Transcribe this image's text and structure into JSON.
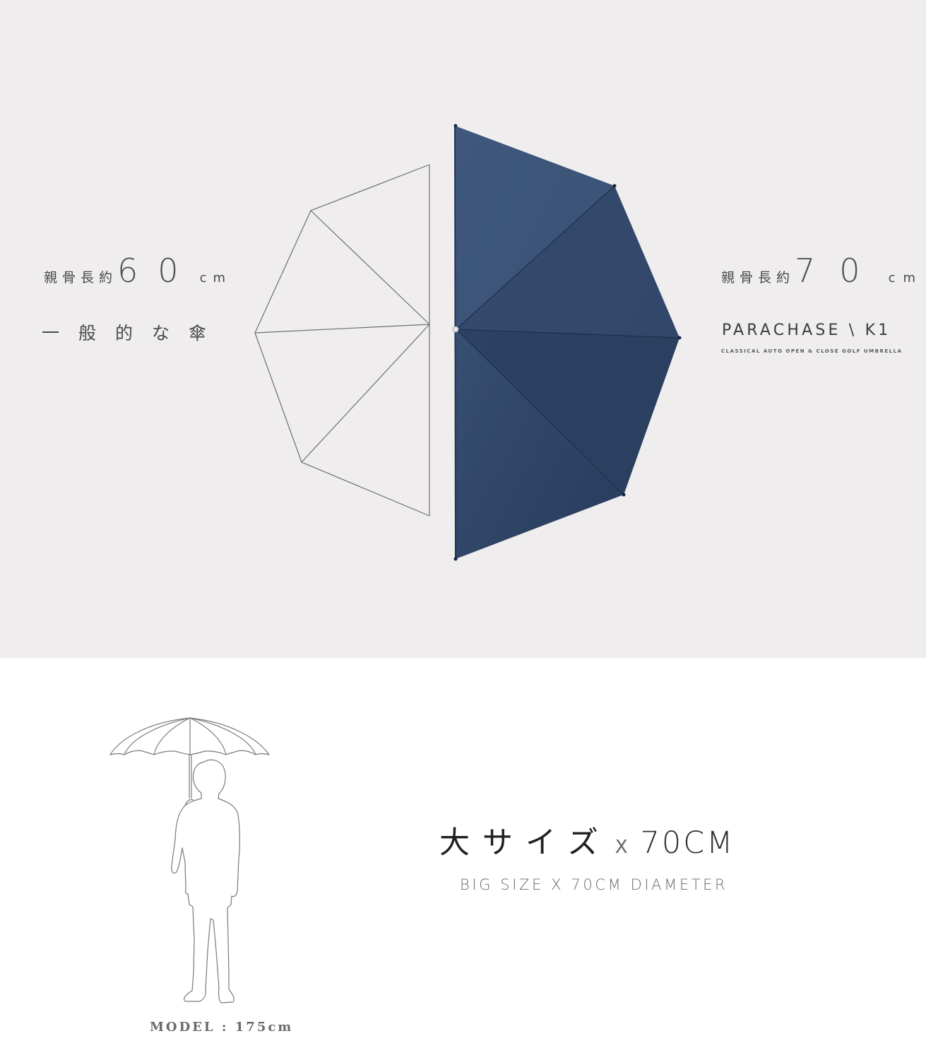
{
  "colors": {
    "panel_background": "#efedee",
    "canopy_navy": "#2f4566",
    "canopy_navy_light": "#3d577b",
    "outline_grey": "#6f6f6f",
    "text_dark": "#3d3d3d"
  },
  "left_spec": {
    "label": "親骨長約",
    "number": "60",
    "unit": "cm",
    "caption": "一般的な傘"
  },
  "right_spec": {
    "label": "親骨長約",
    "number": "70",
    "unit": "cm",
    "brand": "PARACHASE \\ K1",
    "tagline": "CLASSICAL AUTO OPEN & CLOSE GOLF UMBRELLA"
  },
  "headline": {
    "jp": "大サイズ",
    "x": "X",
    "size": "70CM"
  },
  "subheadline": "BIG SIZE X 70CM DIAMETER",
  "model_caption": "MODEL : 175cm",
  "icons": {
    "outline_umbrella": "outline-umbrella-icon",
    "navy_umbrella": "navy-umbrella-icon",
    "person_with_umbrella": "person-with-umbrella-icon"
  }
}
